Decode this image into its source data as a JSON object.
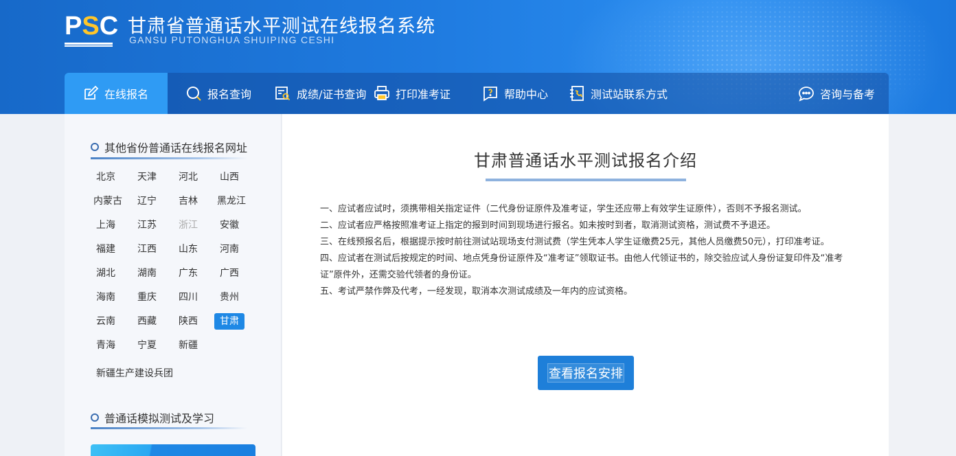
{
  "header": {
    "logo_text_p": "P",
    "logo_text_s": "S",
    "logo_text_c": "C",
    "title": "甘肃省普通话水平测试在线报名系统",
    "subtitle": "GANSU PUTONGHUA SHUIPING CESHI",
    "colors": {
      "banner": "#1f7be0",
      "accent": "#ffc62a"
    }
  },
  "nav": {
    "items": [
      {
        "label": "在线报名",
        "icon": "edit-icon",
        "active": true
      },
      {
        "label": "报名查询",
        "icon": "search-icon"
      },
      {
        "label": "成绩/证书查询",
        "icon": "certificate-search-icon"
      },
      {
        "label": "打印准考证",
        "icon": "printer-icon"
      },
      {
        "label": "帮助中心",
        "icon": "help-icon"
      },
      {
        "label": "测试站联系方式",
        "icon": "contact-book-icon"
      },
      {
        "label": "咨询与备考",
        "icon": "chat-icon"
      }
    ],
    "active_color": "#2f9bf4"
  },
  "sidebar": {
    "provinces_title": "其他省份普通话在线报名网址",
    "provinces": [
      {
        "label": "北京"
      },
      {
        "label": "天津"
      },
      {
        "label": "河北"
      },
      {
        "label": "山西"
      },
      {
        "label": "内蒙古"
      },
      {
        "label": "辽宁"
      },
      {
        "label": "吉林"
      },
      {
        "label": "黑龙江"
      },
      {
        "label": "上海"
      },
      {
        "label": "江苏"
      },
      {
        "label": "浙江",
        "disabled": true
      },
      {
        "label": "安徽"
      },
      {
        "label": "福建"
      },
      {
        "label": "江西"
      },
      {
        "label": "山东"
      },
      {
        "label": "河南"
      },
      {
        "label": "湖北"
      },
      {
        "label": "湖南"
      },
      {
        "label": "广东"
      },
      {
        "label": "广西"
      },
      {
        "label": "海南"
      },
      {
        "label": "重庆"
      },
      {
        "label": "四川"
      },
      {
        "label": "贵州"
      },
      {
        "label": "云南"
      },
      {
        "label": "西藏"
      },
      {
        "label": "陕西"
      },
      {
        "label": "甘肃",
        "active": true
      },
      {
        "label": "青海"
      },
      {
        "label": "宁夏"
      },
      {
        "label": "新疆"
      }
    ],
    "corps": "新疆生产建设兵团",
    "practice_title": "普通话模拟测试及学习"
  },
  "main": {
    "title": "甘肃普通话水平测试报名介绍",
    "notices": [
      "一、应试者应试时，须携带相关指定证件（二代身份证原件及准考证，学生还应带上有效学生证原件），否则不予报名测试。",
      "二、应试者应严格按照准考证上指定的报到时间到现场进行报名。如未按时到者，取消测试资格，测试费不予退还。",
      "三、在线预报名后，根据提示按时前往测试站现场支付测试费（学生凭本人学生证缴费25元，其他人员缴费50元），打印准考证。",
      "四、应试者在测试后按规定的时间、地点凭身份证原件及“准考证”领取证书。由他人代领证书的，除交验应试人身份证复印件及“准考证”原件外，还需交验代领者的身份证。",
      "五、考试严禁作弊及代考，一经发现，取消本次测试成绩及一年内的应试资格。"
    ],
    "button_label": "查看报名安排"
  }
}
